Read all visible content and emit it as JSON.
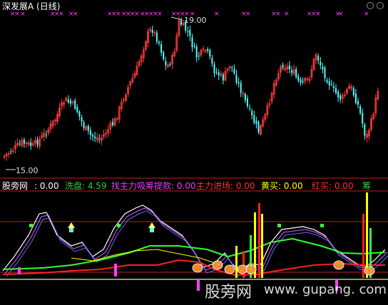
{
  "window": {
    "title": "深发展A (日线)"
  },
  "upper_panel": {
    "high_label": "19.00",
    "low_label": "15.00"
  },
  "indicator_bar": {
    "name": "股旁网",
    "name_value": ": 0.00",
    "items": [
      {
        "label": "洗盘: 4.59",
        "color": "#33cc33"
      },
      {
        "label": "找主力吸筹提款: 0.00",
        "color": "#e040ff"
      },
      {
        "label": "主力进场: 0.00",
        "color": "#ff3030"
      },
      {
        "label": "黄买: 0.00",
        "color": "#ffff00"
      },
      {
        "label": "红买: 0.00",
        "color": "#ff3030"
      },
      {
        "label": "筹",
        "color": "#33cc33"
      }
    ]
  },
  "watermark": {
    "cn": "股旁网",
    "url": "www. gupang. com"
  },
  "colors": {
    "up": "#ff3b3b",
    "down": "#55ffff",
    "magenta": "#ff40ff",
    "green": "#33ff33",
    "yellow": "#ffff00",
    "red_line": "#ff2020",
    "frame": "#c02020"
  }
}
